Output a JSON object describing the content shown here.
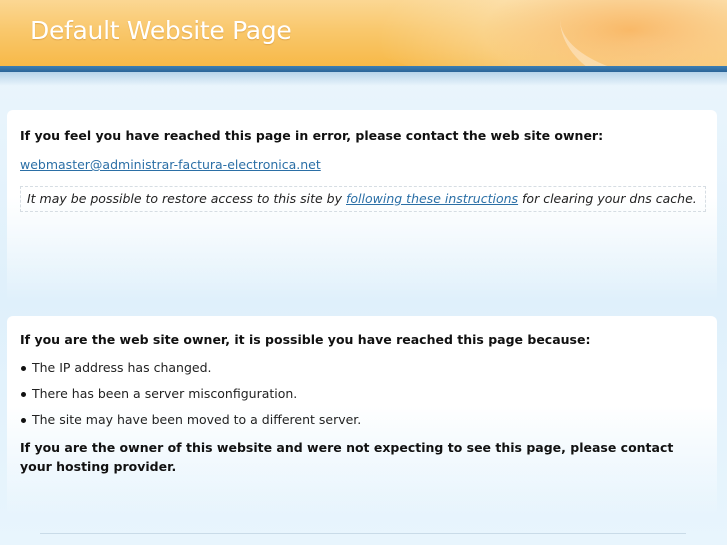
{
  "header": {
    "title": "Default Website Page"
  },
  "contact_panel": {
    "heading": "If you feel you have reached this page in error, please contact the web site owner:",
    "email": "webmaster@administrar-factura-electronica.net",
    "note_before": "It may be possible to restore access to this site by ",
    "note_link": "following these instructions",
    "note_after": " for clearing your dns cache."
  },
  "owner_panel": {
    "heading": "If you are the web site owner, it is possible you have reached this page because:",
    "reasons": [
      "The IP address has changed.",
      "There has been a server misconfiguration.",
      "The site may have been moved to a different server."
    ],
    "footer": "If you are the owner of this website and were not expecting to see this page, please contact your hosting provider."
  },
  "colors": {
    "header_orange": "#f9c86d",
    "header_bar_blue": "#2a6498",
    "link_blue": "#2b6fa6"
  }
}
